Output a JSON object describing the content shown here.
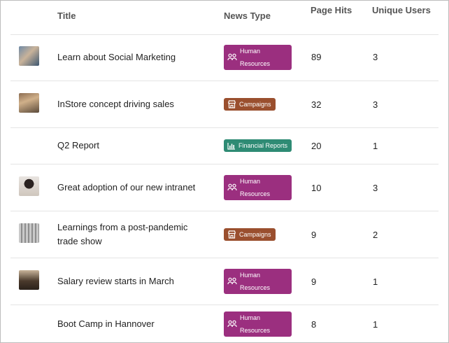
{
  "header": {
    "title": "Title",
    "news_type": "News Type",
    "page_hits": "Page Hits",
    "unique_users": "Unique Users"
  },
  "colors": {
    "human_resources": "#9b2f7f",
    "campaigns": "#9a4f2e",
    "financial_reports": "#2e8b74"
  },
  "rows": [
    {
      "title": "Learn about Social Marketing",
      "type": "Human Resources",
      "icon": "people-icon",
      "hits": "89",
      "users": "3",
      "thumb": "photo"
    },
    {
      "title": "InStore concept driving sales",
      "type": "Campaigns",
      "icon": "store-icon",
      "hits": "32",
      "users": "3",
      "thumb": "photo"
    },
    {
      "title": "Q2 Report",
      "type": "Financial Reports",
      "icon": "bar-chart-icon",
      "hits": "20",
      "users": "1",
      "thumb": ""
    },
    {
      "title": "Great adoption of our new intranet",
      "type": "Human Resources",
      "icon": "people-icon",
      "hits": "10",
      "users": "3",
      "thumb": "photo"
    },
    {
      "title": "Learnings from a post-pandemic trade show",
      "type": "Campaigns",
      "icon": "store-icon",
      "hits": "9",
      "users": "2",
      "thumb": "photo"
    },
    {
      "title": "Salary review starts in March",
      "type": "Human Resources",
      "icon": "people-icon",
      "hits": "9",
      "users": "1",
      "thumb": "photo"
    },
    {
      "title": "Boot Camp in Hannover",
      "type": "Human Resources",
      "icon": "people-icon",
      "hits": "8",
      "users": "1",
      "thumb": ""
    }
  ]
}
